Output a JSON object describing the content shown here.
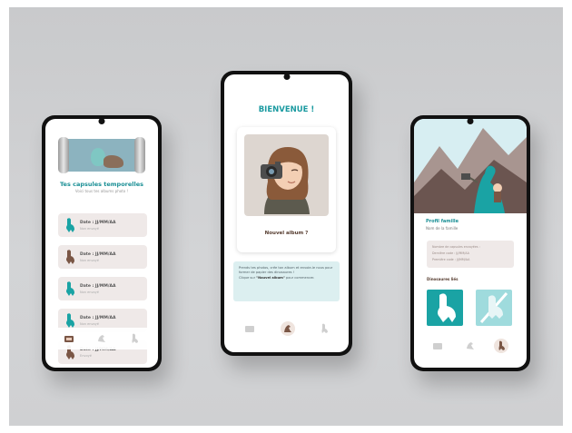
{
  "left_phone": {
    "title": "Tes capsules temporelles",
    "subtitle": "Voici tous tes albums photo !",
    "items": [
      {
        "date": "Date : JJ/MM/AA",
        "note": "Non envoyé",
        "color": "#1aa3a4"
      },
      {
        "date": "Date : JJ/MM/AA",
        "note": "Non envoyé",
        "color": "#7a5645"
      },
      {
        "date": "Date : JJ/MM/AA",
        "note": "Non envoyé",
        "color": "#1aa3a4"
      },
      {
        "date": "Date : JJ/MM/AA",
        "note": "Non envoyé",
        "color": "#1aa3a4"
      },
      {
        "date": "Date : JJ/MM/AA",
        "note": "Envoyé",
        "color": "#7a5645"
      }
    ],
    "nav_icons": [
      "album-icon",
      "dino-fossil-icon",
      "dino-icon"
    ]
  },
  "middle_phone": {
    "welcome": "BIENVENUE !",
    "card_label": "Nouvel album ?",
    "info_text": "Prends tes photos, crée ton album et envoie-le nous pour former de papier des dinosaures !",
    "info_text_2_prefix": "Clique sur ",
    "info_text_2_bold": "\"Nouvel album\"",
    "info_text_2_suffix": " pour commencer.",
    "nav_icons": [
      "album-icon",
      "dino-fossil-icon",
      "dino-icon"
    ]
  },
  "right_phone": {
    "profile_title": "Profil famille",
    "profile_sub": "Nom de la famille",
    "stats": [
      "Nombre de capsules envoyées :",
      "Dernière code : JJ/MM/AA",
      "Première code : JJ/MM/AA"
    ],
    "dinos_title": "Dinosaures liés",
    "nav_icons": [
      "album-icon",
      "dino-fossil-icon",
      "dino-icon"
    ]
  },
  "colors": {
    "teal": "#1aa3a4",
    "brown": "#7a5645",
    "light_teal": "#dceff0",
    "beige": "#efe9e8"
  }
}
